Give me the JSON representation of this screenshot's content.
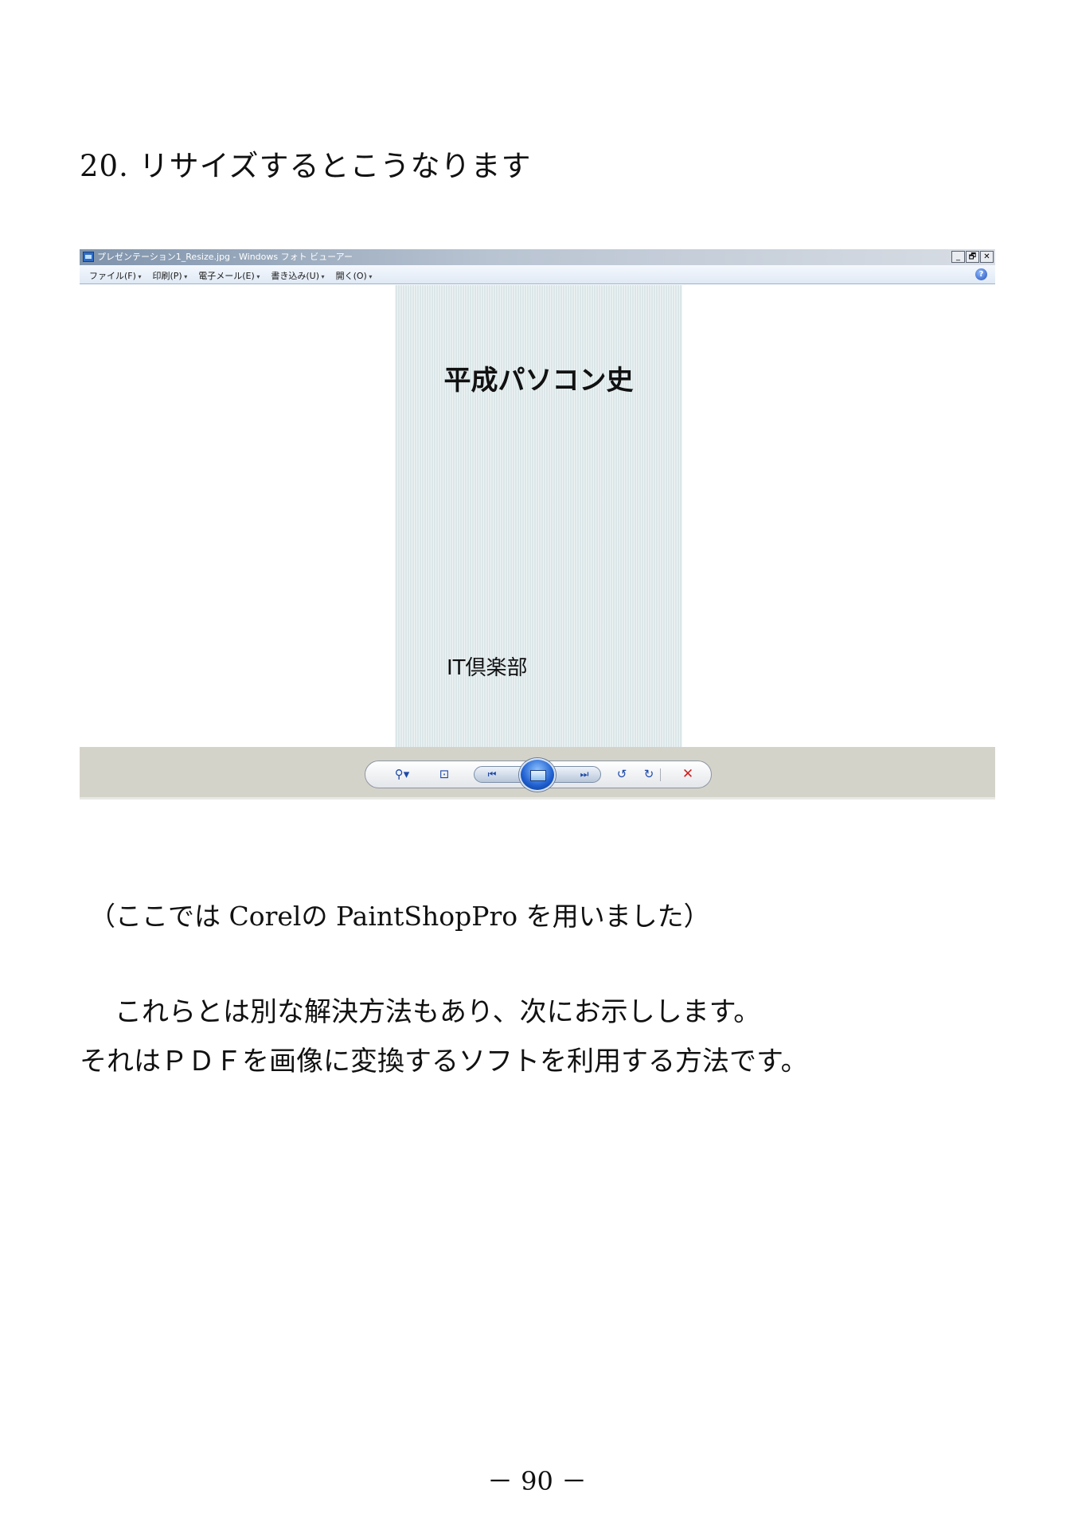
{
  "heading": "20. リサイズするとこうなります",
  "screenshot": {
    "title": "プレゼンテーション1_Resize.jpg - Windows フォト ビューアー",
    "window_buttons": [
      "_",
      "🗗",
      "✕"
    ],
    "menu": [
      "ファイル(F)",
      "印刷(P)",
      "電子メール(E)",
      "書き込み(U)",
      "開く(O)"
    ],
    "help": "?",
    "slide_title": "平成パソコン史",
    "slide_subtitle": "IT倶楽部",
    "controls": {
      "zoom": "⚲▾",
      "fit": "⊡",
      "prev": "⏮",
      "next": "⏭",
      "rotate_left": "↺",
      "rotate_right": "↻",
      "delete": "✕"
    }
  },
  "note": "（ここでは Corelの PaintShopPro を用いました）",
  "paragraphs": [
    "これらとは別な解決方法もあり、次にお示しします。",
    "それはＰＤＦを画像に変換するソフトを利用する方法です。"
  ],
  "page_number": "－ 90 －"
}
